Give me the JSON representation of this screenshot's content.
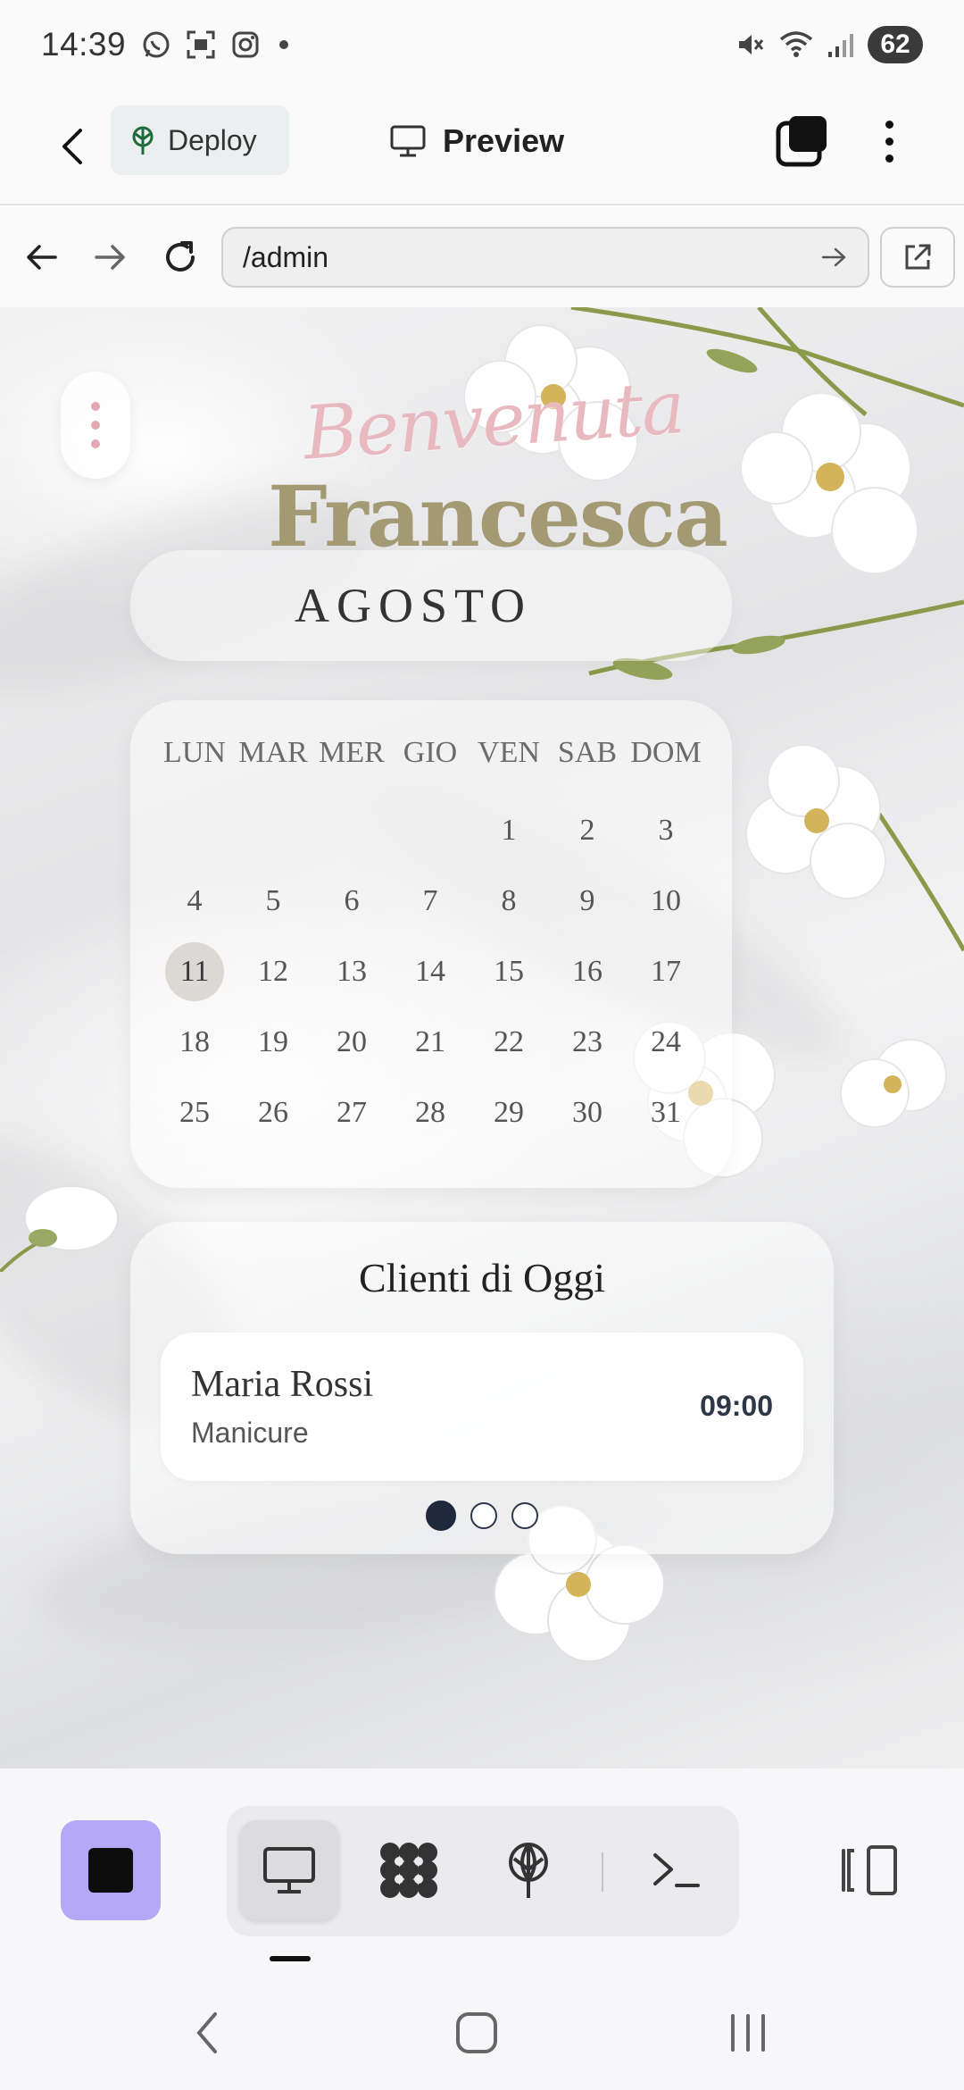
{
  "status_bar": {
    "time": "14:39",
    "battery": "62",
    "left_icons": [
      "whatsapp-icon",
      "screenshot-icon",
      "instagram-icon",
      "dot-icon"
    ],
    "right_icons": [
      "mute-icon",
      "wifi-icon",
      "signal-icon"
    ]
  },
  "app_bar": {
    "deploy_label": "Deploy",
    "title": "Preview"
  },
  "url_bar": {
    "value": "/admin"
  },
  "preview_page": {
    "welcome_script": "Benvenuta",
    "welcome_name": "Francesca",
    "month": "AGOSTO",
    "calendar": {
      "weekdays": [
        "LUN",
        "MAR",
        "MER",
        "GIO",
        "VEN",
        "SAB",
        "DOM"
      ],
      "leading_blanks": 4,
      "days_in_month": 31,
      "today": "11"
    },
    "clients": {
      "title": "Clienti di Oggi",
      "items": [
        {
          "name": "Maria Rossi",
          "service": "Manicure",
          "time": "09:00"
        }
      ],
      "pages": 3,
      "active_page": 1
    }
  },
  "colors": {
    "accent_pink": "#e8bac0",
    "name_olive": "#a39a73",
    "stop_purple": "#b4a7f5",
    "pager_dark": "#1e293b"
  },
  "bottom_toolbar": {
    "tools": [
      "monitor-icon",
      "apps-icon",
      "deploy-icon",
      "terminal-icon"
    ],
    "active_tool": "monitor-icon"
  }
}
